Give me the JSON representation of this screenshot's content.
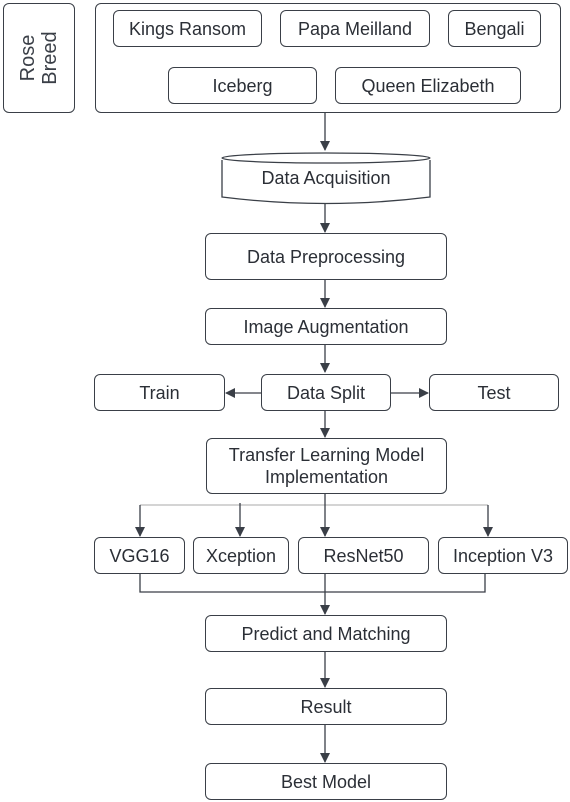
{
  "rose_breed": {
    "label": "Rose Breed",
    "breeds": [
      "Kings Ransom",
      "Papa Meilland",
      "Bengali",
      "Iceberg",
      "Queen Elizabeth"
    ]
  },
  "steps": {
    "acquisition": "Data Acquisition",
    "preprocessing": "Data Preprocessing",
    "augmentation": "Image Augmentation",
    "split": "Data Split",
    "train": "Train",
    "test": "Test",
    "transfer": "Transfer Learning Model Implementation",
    "predict": "Predict and Matching",
    "result": "Result",
    "best": "Best Model"
  },
  "models": [
    "VGG16",
    "Xception",
    "ResNet50",
    "Inception V3"
  ]
}
